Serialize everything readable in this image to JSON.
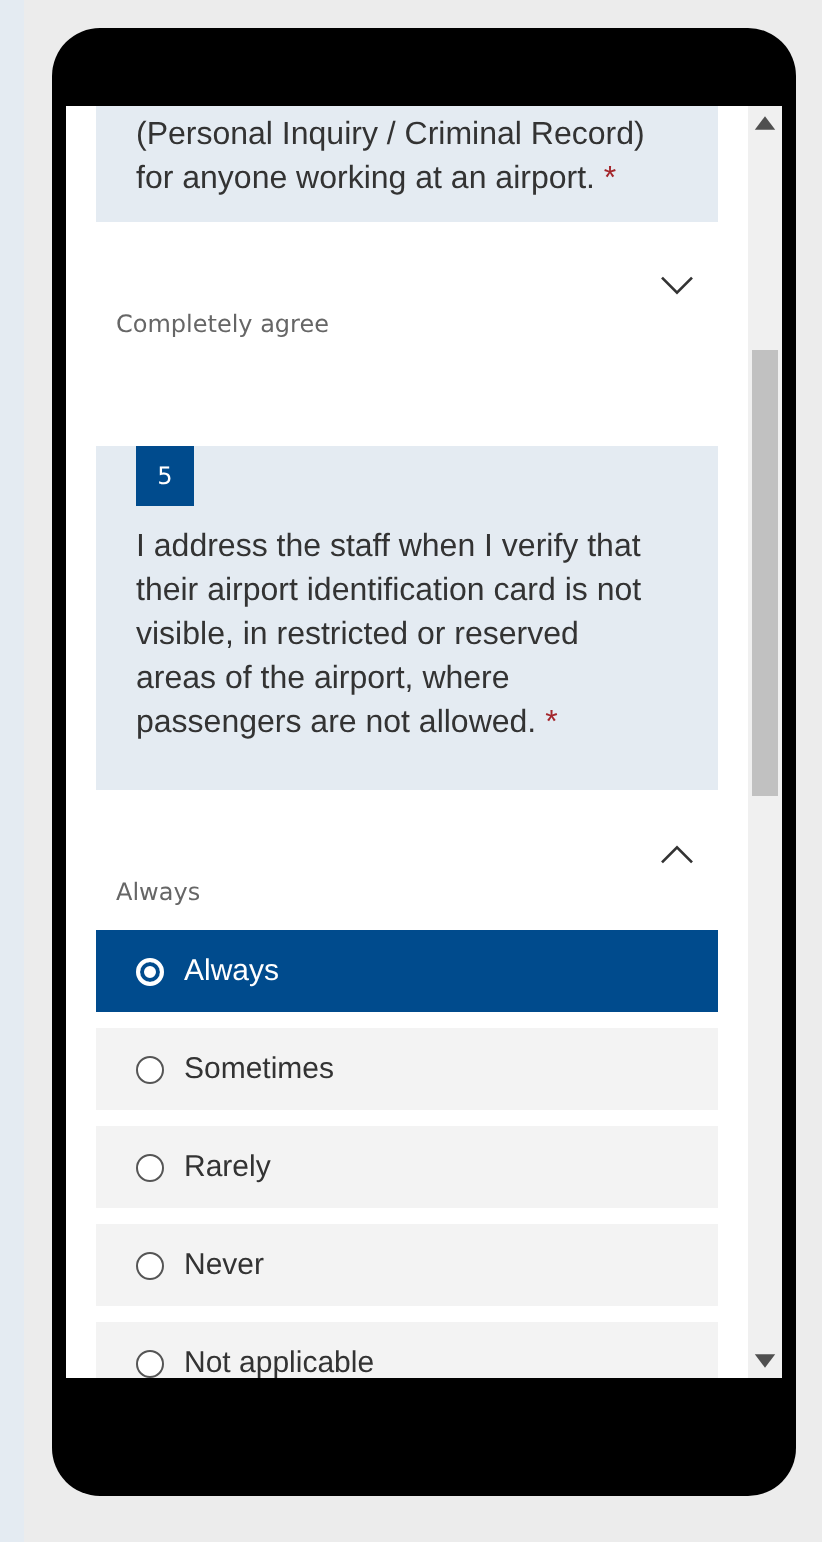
{
  "questions": [
    {
      "text": "(Personal Inquiry / Criminal Record) for anyone working at an airport.",
      "required_mark": "*",
      "answer": {
        "value": "Completely agree",
        "expanded": false
      }
    },
    {
      "number": "5",
      "text": "I address the staff when I verify that their airport identification card is not visible, in restricted or reserved areas of the airport, where passengers are not allowed.",
      "required_mark": "*",
      "answer": {
        "value": "Always",
        "expanded": true,
        "options": [
          {
            "label": "Always",
            "selected": true
          },
          {
            "label": "Sometimes",
            "selected": false
          },
          {
            "label": "Rarely",
            "selected": false
          },
          {
            "label": "Never",
            "selected": false
          },
          {
            "label": "Not applicable",
            "selected": false
          }
        ]
      }
    }
  ]
}
